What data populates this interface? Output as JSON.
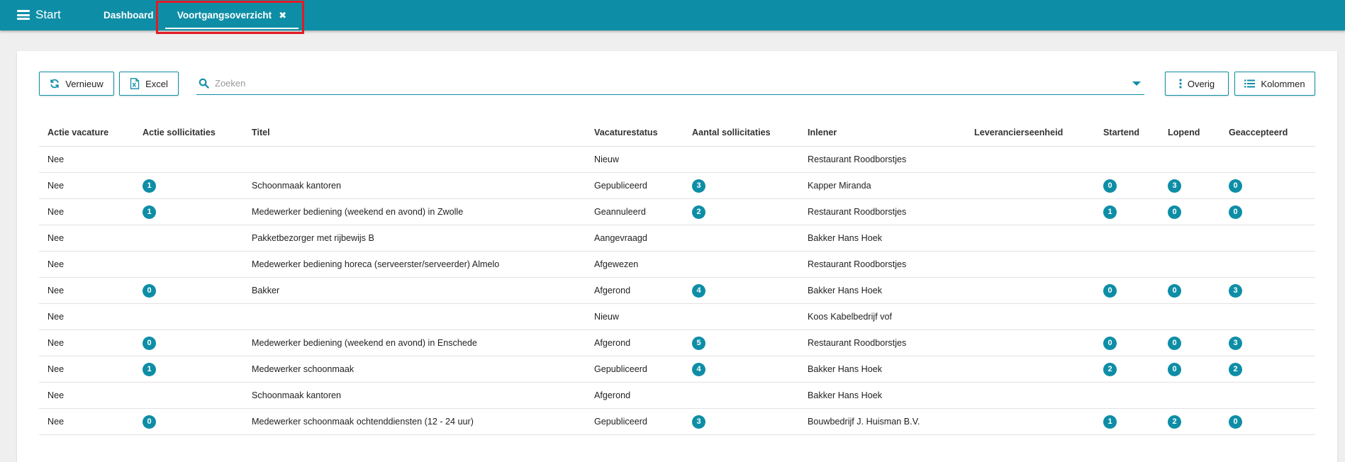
{
  "colors": {
    "accent": "#0e8ea6",
    "highlight": "#e21b24"
  },
  "topbar": {
    "menu_label": "Start",
    "tabs": [
      {
        "label": "Dashboard"
      },
      {
        "label": "Voortgangsoverzicht",
        "close_glyph": "✖"
      }
    ]
  },
  "toolbar": {
    "refresh_label": "Vernieuw",
    "excel_label": "Excel",
    "search_placeholder": "Zoeken",
    "overig_label": "Overig",
    "kolommen_label": "Kolommen"
  },
  "table": {
    "columns": [
      "Actie vacature",
      "Actie sollicitaties",
      "Titel",
      "Vacaturestatus",
      "Aantal sollicitaties",
      "Inlener",
      "Leverancierseenheid",
      "Startend",
      "Lopend",
      "Geaccepteerd"
    ],
    "rows": [
      {
        "actie_vacature": "Nee",
        "actie_sollicitaties": "",
        "titel": "",
        "status": "Nieuw",
        "aantal": "",
        "inlener": "Restaurant Roodborstjes",
        "leverancier": "",
        "startend": "",
        "lopend": "",
        "geaccepteerd": ""
      },
      {
        "actie_vacature": "Nee",
        "actie_sollicitaties": "1",
        "titel": "Schoonmaak kantoren",
        "status": "Gepubliceerd",
        "aantal": "3",
        "inlener": "Kapper Miranda",
        "leverancier": "",
        "startend": "0",
        "lopend": "3",
        "geaccepteerd": "0"
      },
      {
        "actie_vacature": "Nee",
        "actie_sollicitaties": "1",
        "titel": "Medewerker bediening (weekend en avond) in Zwolle",
        "status": "Geannuleerd",
        "aantal": "2",
        "inlener": "Restaurant Roodborstjes",
        "leverancier": "",
        "startend": "1",
        "lopend": "0",
        "geaccepteerd": "0"
      },
      {
        "actie_vacature": "Nee",
        "actie_sollicitaties": "",
        "titel": "Pakketbezorger met rijbewijs B",
        "status": "Aangevraagd",
        "aantal": "",
        "inlener": "Bakker Hans Hoek",
        "leverancier": "",
        "startend": "",
        "lopend": "",
        "geaccepteerd": ""
      },
      {
        "actie_vacature": "Nee",
        "actie_sollicitaties": "",
        "titel": "Medewerker bediening horeca (serveerster/serveerder) Almelo",
        "status": "Afgewezen",
        "aantal": "",
        "inlener": "Restaurant Roodborstjes",
        "leverancier": "",
        "startend": "",
        "lopend": "",
        "geaccepteerd": ""
      },
      {
        "actie_vacature": "Nee",
        "actie_sollicitaties": "0",
        "titel": "Bakker",
        "status": "Afgerond",
        "aantal": "4",
        "inlener": "Bakker Hans Hoek",
        "leverancier": "",
        "startend": "0",
        "lopend": "0",
        "geaccepteerd": "3"
      },
      {
        "actie_vacature": "Nee",
        "actie_sollicitaties": "",
        "titel": "",
        "status": "Nieuw",
        "aantal": "",
        "inlener": "Koos Kabelbedrijf vof",
        "leverancier": "",
        "startend": "",
        "lopend": "",
        "geaccepteerd": ""
      },
      {
        "actie_vacature": "Nee",
        "actie_sollicitaties": "0",
        "titel": "Medewerker bediening (weekend en avond) in Enschede",
        "status": "Afgerond",
        "aantal": "5",
        "inlener": "Restaurant Roodborstjes",
        "leverancier": "",
        "startend": "0",
        "lopend": "0",
        "geaccepteerd": "3"
      },
      {
        "actie_vacature": "Nee",
        "actie_sollicitaties": "1",
        "titel": "Medewerker schoonmaak",
        "status": "Gepubliceerd",
        "aantal": "4",
        "inlener": "Bakker Hans Hoek",
        "leverancier": "",
        "startend": "2",
        "lopend": "0",
        "geaccepteerd": "2"
      },
      {
        "actie_vacature": "Nee",
        "actie_sollicitaties": "",
        "titel": "Schoonmaak kantoren",
        "status": "Afgerond",
        "aantal": "",
        "inlener": "Bakker Hans Hoek",
        "leverancier": "",
        "startend": "",
        "lopend": "",
        "geaccepteerd": ""
      },
      {
        "actie_vacature": "Nee",
        "actie_sollicitaties": "0",
        "titel": "Medewerker schoonmaak ochtenddiensten (12 - 24 uur)",
        "status": "Gepubliceerd",
        "aantal": "3",
        "inlener": "Bouwbedrijf J. Huisman B.V.",
        "leverancier": "",
        "startend": "1",
        "lopend": "2",
        "geaccepteerd": "0"
      }
    ]
  }
}
